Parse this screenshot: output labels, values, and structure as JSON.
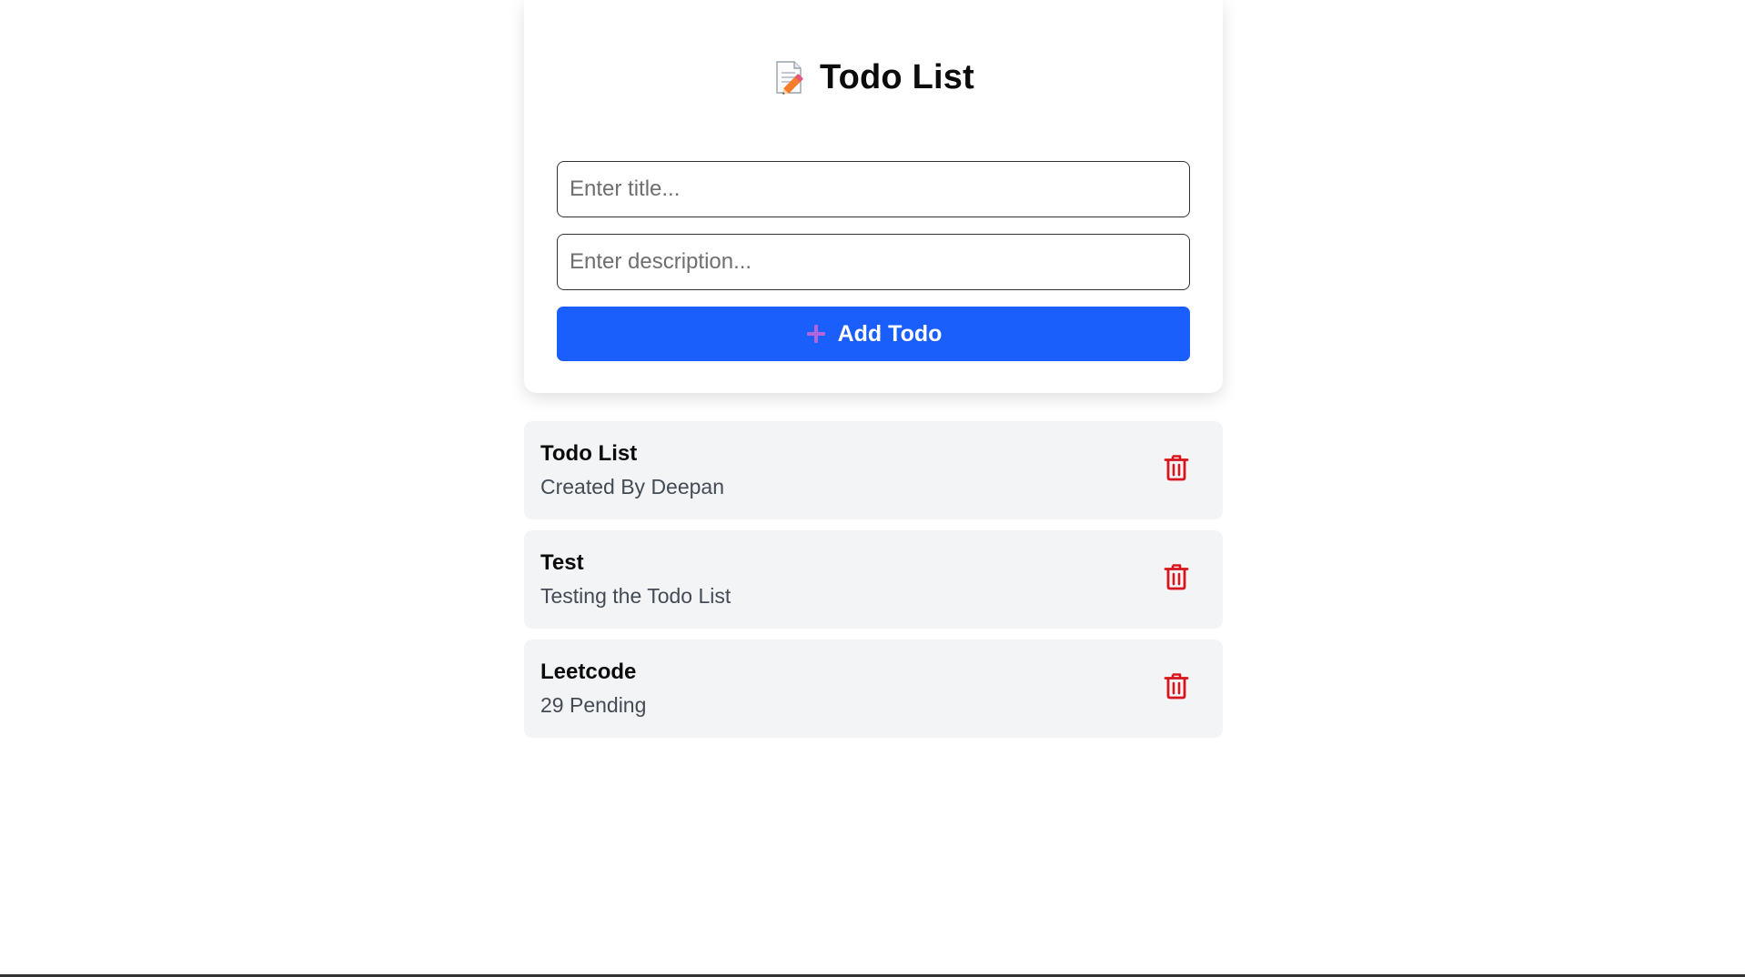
{
  "header": {
    "title": "Todo List",
    "icon": "memo-pencil-icon"
  },
  "form": {
    "title_placeholder": "Enter title...",
    "title_value": "",
    "description_placeholder": "Enter description...",
    "description_value": "",
    "add_button_label": "Add Todo",
    "add_button_icon": "plus-icon"
  },
  "todos": [
    {
      "title": "Todo List",
      "description": "Created By Deepan",
      "delete_icon": "trash-icon"
    },
    {
      "title": "Test",
      "description": "Testing the Todo List",
      "delete_icon": "trash-icon"
    },
    {
      "title": "Leetcode",
      "description": "29 Pending",
      "delete_icon": "trash-icon"
    }
  ],
  "colors": {
    "primary": "#1a5ffb",
    "delete": "#d9141c",
    "item_bg": "#f3f4f6",
    "plus_icon": "#b565d9"
  }
}
